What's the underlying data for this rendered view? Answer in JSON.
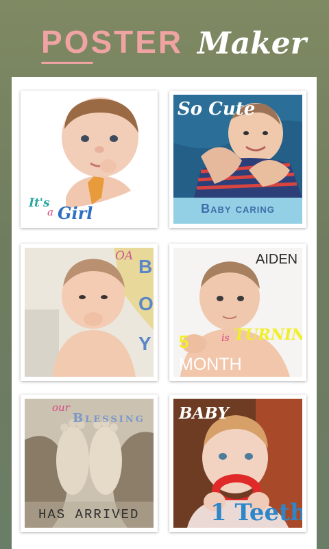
{
  "header": {
    "title_bold": "POSTER",
    "title_script": "Maker"
  },
  "posters": [
    {
      "id": "its-a-girl",
      "line1": "It's",
      "line2": "a",
      "line3": "Girl"
    },
    {
      "id": "so-cute",
      "top": "So Cute",
      "banner": "Baby caring"
    },
    {
      "id": "oh-a-boy",
      "small": "OA",
      "letters": [
        "B",
        "O",
        "Y"
      ]
    },
    {
      "id": "aiden",
      "name": "AIDEN",
      "age": "5",
      "is": "is",
      "turning": "TURNING",
      "month": "MONTH"
    },
    {
      "id": "blessing",
      "our": "our",
      "blessing": "Blessing",
      "arrived": "HAS ARRIVED"
    },
    {
      "id": "teeth",
      "top": "BABY",
      "bottom": "1 Teeth"
    }
  ],
  "colors": {
    "accent_pink": "#f0a3a3",
    "girl_teal": "#2aa7a0",
    "girl_pink": "#d6457f",
    "girl_blue": "#2e6fc4",
    "banner_bg": "#93d0e6",
    "boy_blue": "#5b87c6",
    "turning_yellow": "#f0ef2a"
  }
}
